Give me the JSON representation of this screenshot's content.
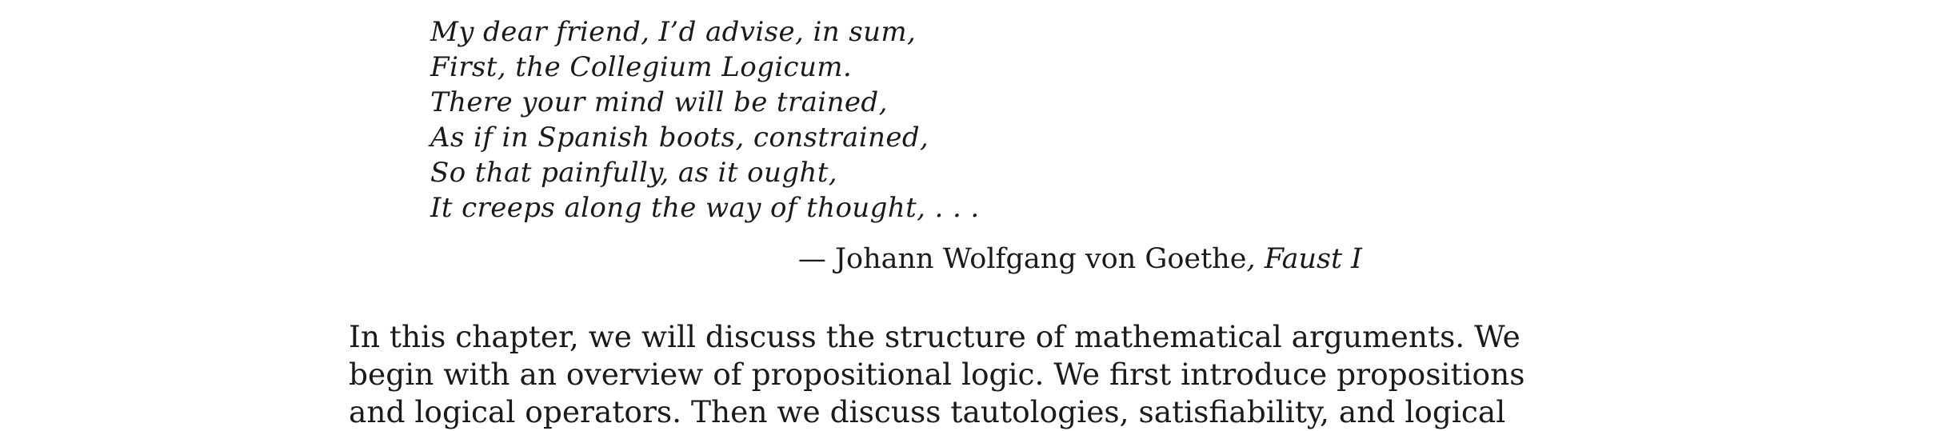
{
  "epigraph": {
    "lines": [
      "My dear friend, I’d advise, in sum,",
      "First, the Collegium Logicum.",
      "There your mind will be trained,",
      "As if in Spanish boots, constrained,",
      "So that painfully, as it ought,",
      "It creeps along the way of thought, . . ."
    ],
    "attribution": {
      "dash_author": "— Johann Wolfgang von Goethe",
      "separator": ", ",
      "work": "Faust I"
    }
  },
  "body": {
    "lines": [
      "In this chapter, we will discuss the structure of mathematical arguments. We",
      "begin with an overview of propositional logic. We first introduce propositions",
      "and logical operators. Then we discuss tautologies, satisfiability, and logical"
    ]
  }
}
